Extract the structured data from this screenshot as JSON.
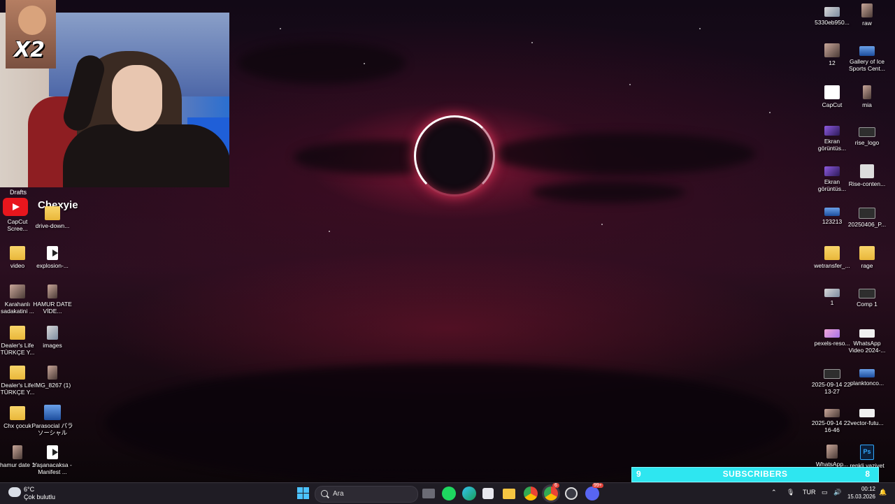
{
  "overlay": {
    "meme_text": "X2",
    "drafts_label": "Drafts",
    "channel_name": "Chexyie"
  },
  "desktop_left": [
    {
      "label": "CapCut Scree...",
      "icon": "youtube-icon"
    },
    {
      "label": "drive-down...",
      "icon": "folder-icon"
    },
    {
      "label": "video",
      "icon": "folder-icon"
    },
    {
      "label": "explosion-...",
      "icon": "video-file-icon"
    },
    {
      "label": "Karahanlı sadakatini ...",
      "icon": "photo-icon"
    },
    {
      "label": "HAMUR DATE VİDE...",
      "icon": "photo-icon"
    },
    {
      "label": "Dealer's Life TÜRKÇE Y...",
      "icon": "folder-icon"
    },
    {
      "label": "images",
      "icon": "photo-icon"
    },
    {
      "label": "Dealer's Life TÜRKÇE Y...",
      "icon": "folder-icon"
    },
    {
      "label": "IMG_8267 (1)",
      "icon": "photo-icon"
    },
    {
      "label": "Chx çocuk",
      "icon": "folder-icon"
    },
    {
      "label": "Parasocial パラソーシャル",
      "icon": "image-icon"
    },
    {
      "label": "hamur date 1",
      "icon": "photo-icon"
    },
    {
      "label": "Yaşanacaksa - Manifest ...",
      "icon": "video-file-icon"
    }
  ],
  "desktop_right": [
    {
      "label": "5330eb950...",
      "icon": "image-icon"
    },
    {
      "label": "raw",
      "icon": "photo-icon"
    },
    {
      "label": "12",
      "icon": "photo-icon"
    },
    {
      "label": "Gallery of Ice Sports Cent...",
      "icon": "image-icon"
    },
    {
      "label": "CapCut",
      "icon": "capcut-icon"
    },
    {
      "label": "mia",
      "icon": "photo-icon"
    },
    {
      "label": "Ekran görüntüs...",
      "icon": "image-icon"
    },
    {
      "label": "rise_logo",
      "icon": "image-icon"
    },
    {
      "label": "Ekran görüntüs...",
      "icon": "image-icon"
    },
    {
      "label": "Rise-conten...",
      "icon": "image-icon"
    },
    {
      "label": "123213",
      "icon": "image-icon"
    },
    {
      "label": "20250406_P...",
      "icon": "image-icon"
    },
    {
      "label": "wetransfer_...",
      "icon": "folder-icon"
    },
    {
      "label": "rage",
      "icon": "folder-icon"
    },
    {
      "label": "1",
      "icon": "image-icon"
    },
    {
      "label": "Comp 1",
      "icon": "image-icon"
    },
    {
      "label": "pexels-reso...",
      "icon": "image-icon"
    },
    {
      "label": "WhatsApp Video 2024-...",
      "icon": "video-file-icon"
    },
    {
      "label": "2025-09-14 22-13-27",
      "icon": "video-file-icon"
    },
    {
      "label": "planktonco...",
      "icon": "image-icon"
    },
    {
      "label": "2025-09-14 22-16-46",
      "icon": "video-file-icon"
    },
    {
      "label": "vector-futu...",
      "icon": "image-icon"
    },
    {
      "label": "WhatsApp...",
      "icon": "photo-icon"
    },
    {
      "label": "renkli yaziyet",
      "icon": "photoshop-icon"
    }
  ],
  "sub_goal": {
    "left_value": "9",
    "label": "SUBSCRIBERS",
    "right_value": "8"
  },
  "taskbar": {
    "weather_temp": "6°C",
    "weather_desc": "Çok bulutlu",
    "search_placeholder": "Ara",
    "language": "TUR",
    "time": "00:12",
    "date": "15.03.2026",
    "chrome_badge": "6",
    "discord_badge": "99+"
  },
  "colors": {
    "sub_bar": "#2ee6f0",
    "start_blue": "#4cc2ff",
    "taskbar_bg": "#1f1c24"
  }
}
